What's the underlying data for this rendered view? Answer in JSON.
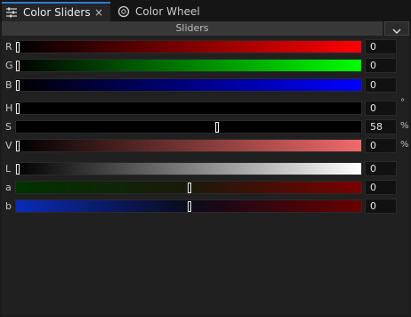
{
  "tabs": [
    {
      "label": "Color Sliders"
    },
    {
      "label": "Color Wheel"
    }
  ],
  "header": {
    "title": "Sliders"
  },
  "icons": {
    "sliders_tab": "sliders-icon",
    "wheel_tab": "color-wheel-icon",
    "close": "close-icon",
    "dropdown": "chevron-down-icon"
  },
  "close_glyph": "×",
  "rows": [
    {
      "label": "R",
      "value": "0",
      "unit": "",
      "level": 0,
      "gradient": "linear-gradient(to right,#000000,#ff0000)"
    },
    {
      "label": "G",
      "value": "0",
      "unit": "",
      "level": 0,
      "gradient": "linear-gradient(to right,#000000,#00ff00)"
    },
    {
      "label": "B",
      "value": "0",
      "unit": "",
      "level": 0,
      "gradient": "linear-gradient(to right,#000000,#0000ff)"
    },
    {
      "label": "H",
      "value": "0",
      "unit": "°",
      "level": 0,
      "gradient": "linear-gradient(to right,#000000,#000000)"
    },
    {
      "label": "S",
      "value": "58",
      "unit": "%",
      "level": 0.58,
      "gradient": "linear-gradient(to right,#000000,#000000)"
    },
    {
      "label": "V",
      "value": "0",
      "unit": "%",
      "level": 0,
      "gradient": "linear-gradient(to right,#000000,#f06a6a)"
    },
    {
      "label": "L",
      "value": "0",
      "unit": "",
      "level": 0,
      "gradient": "linear-gradient(to right,#000000,#ffffff)"
    },
    {
      "label": "a",
      "value": "0",
      "unit": "",
      "level": 0.5,
      "gradient": "linear-gradient(to right,#003300,#1a1a0a 50%,#7a0000)"
    },
    {
      "label": "b",
      "value": "0",
      "unit": "",
      "level": 0.5,
      "gradient": "linear-gradient(to right,#0a2bb8,#0a0a1a 50%,#6a0000)"
    }
  ]
}
